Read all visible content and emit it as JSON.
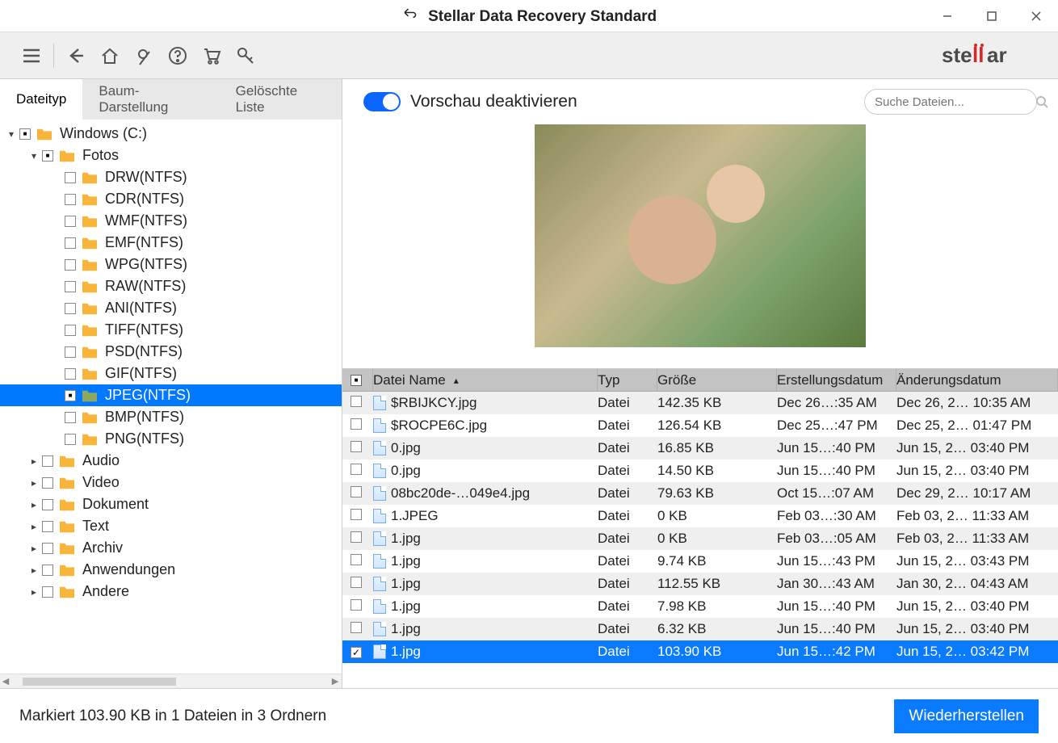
{
  "window": {
    "title": "Stellar Data Recovery Standard"
  },
  "toolbar": {
    "logo_text": "stellar"
  },
  "tabs": [
    {
      "label": "Dateityp",
      "active": true
    },
    {
      "label": "Baum-Darstellung",
      "active": false
    },
    {
      "label": "Gelöschte Liste",
      "active": false
    }
  ],
  "tree": [
    {
      "label": "Windows (C:)",
      "depth": 0,
      "caret": "down",
      "check": "partial"
    },
    {
      "label": "Fotos",
      "depth": 1,
      "caret": "down",
      "check": "partial"
    },
    {
      "label": "DRW(NTFS)",
      "depth": 2,
      "caret": "",
      "check": "empty"
    },
    {
      "label": "CDR(NTFS)",
      "depth": 2,
      "caret": "",
      "check": "empty"
    },
    {
      "label": "WMF(NTFS)",
      "depth": 2,
      "caret": "",
      "check": "empty"
    },
    {
      "label": "EMF(NTFS)",
      "depth": 2,
      "caret": "",
      "check": "empty"
    },
    {
      "label": "WPG(NTFS)",
      "depth": 2,
      "caret": "",
      "check": "empty"
    },
    {
      "label": "RAW(NTFS)",
      "depth": 2,
      "caret": "",
      "check": "empty"
    },
    {
      "label": "ANI(NTFS)",
      "depth": 2,
      "caret": "",
      "check": "empty"
    },
    {
      "label": "TIFF(NTFS)",
      "depth": 2,
      "caret": "",
      "check": "empty"
    },
    {
      "label": "PSD(NTFS)",
      "depth": 2,
      "caret": "",
      "check": "empty"
    },
    {
      "label": "GIF(NTFS)",
      "depth": 2,
      "caret": "",
      "check": "empty"
    },
    {
      "label": "JPEG(NTFS)",
      "depth": 2,
      "caret": "",
      "check": "partial",
      "selected": true
    },
    {
      "label": "BMP(NTFS)",
      "depth": 2,
      "caret": "",
      "check": "empty"
    },
    {
      "label": "PNG(NTFS)",
      "depth": 2,
      "caret": "",
      "check": "empty"
    },
    {
      "label": "Audio",
      "depth": 1,
      "caret": "right",
      "check": "empty"
    },
    {
      "label": "Video",
      "depth": 1,
      "caret": "right",
      "check": "empty"
    },
    {
      "label": "Dokument",
      "depth": 1,
      "caret": "right",
      "check": "empty"
    },
    {
      "label": "Text",
      "depth": 1,
      "caret": "right",
      "check": "empty"
    },
    {
      "label": "Archiv",
      "depth": 1,
      "caret": "right",
      "check": "empty"
    },
    {
      "label": "Anwendungen",
      "depth": 1,
      "caret": "right",
      "check": "empty"
    },
    {
      "label": "Andere",
      "depth": 1,
      "caret": "right",
      "check": "empty"
    }
  ],
  "preview": {
    "toggle_label": "Vorschau deaktivieren",
    "search_placeholder": "Suche Dateien..."
  },
  "columns": {
    "name": "Datei Name",
    "type": "Typ",
    "size": "Größe",
    "created": "Erstellungsdatum",
    "modified": "Änderungsdatum"
  },
  "files": [
    {
      "name": "$RBIJKCY.jpg",
      "type": "Datei",
      "size": "142.35 KB",
      "created": "Dec 26…:35 AM",
      "modified": "Dec 26, 2… 10:35 AM",
      "checked": false
    },
    {
      "name": "$ROCPE6C.jpg",
      "type": "Datei",
      "size": "126.54 KB",
      "created": "Dec 25…:47 PM",
      "modified": "Dec 25, 2… 01:47 PM",
      "checked": false
    },
    {
      "name": "0.jpg",
      "type": "Datei",
      "size": "16.85 KB",
      "created": "Jun 15…:40 PM",
      "modified": "Jun 15, 2… 03:40 PM",
      "checked": false
    },
    {
      "name": "0.jpg",
      "type": "Datei",
      "size": "14.50 KB",
      "created": "Jun 15…:40 PM",
      "modified": "Jun 15, 2… 03:40 PM",
      "checked": false
    },
    {
      "name": "08bc20de-…049e4.jpg",
      "type": "Datei",
      "size": "79.63 KB",
      "created": "Oct 15…:07 AM",
      "modified": "Dec 29, 2… 10:17 AM",
      "checked": false
    },
    {
      "name": "1.JPEG",
      "type": "Datei",
      "size": "0 KB",
      "created": "Feb 03…:30 AM",
      "modified": "Feb 03, 2… 11:33 AM",
      "checked": false
    },
    {
      "name": "1.jpg",
      "type": "Datei",
      "size": "0 KB",
      "created": "Feb 03…:05 AM",
      "modified": "Feb 03, 2… 11:33 AM",
      "checked": false
    },
    {
      "name": "1.jpg",
      "type": "Datei",
      "size": "9.74 KB",
      "created": "Jun 15…:43 PM",
      "modified": "Jun 15, 2… 03:43 PM",
      "checked": false
    },
    {
      "name": "1.jpg",
      "type": "Datei",
      "size": "112.55 KB",
      "created": "Jan 30…:43 AM",
      "modified": "Jan 30, 2… 04:43 AM",
      "checked": false
    },
    {
      "name": "1.jpg",
      "type": "Datei",
      "size": "7.98 KB",
      "created": "Jun 15…:40 PM",
      "modified": "Jun 15, 2… 03:40 PM",
      "checked": false
    },
    {
      "name": "1.jpg",
      "type": "Datei",
      "size": "6.32 KB",
      "created": "Jun 15…:40 PM",
      "modified": "Jun 15, 2… 03:40 PM",
      "checked": false
    },
    {
      "name": "1.jpg",
      "type": "Datei",
      "size": "103.90 KB",
      "created": "Jun 15…:42 PM",
      "modified": "Jun 15, 2… 03:42 PM",
      "checked": true,
      "selected": true
    }
  ],
  "footer": {
    "status": "Markiert 103.90 KB in 1 Dateien in 3 Ordnern",
    "recover_label": "Wiederherstellen"
  }
}
